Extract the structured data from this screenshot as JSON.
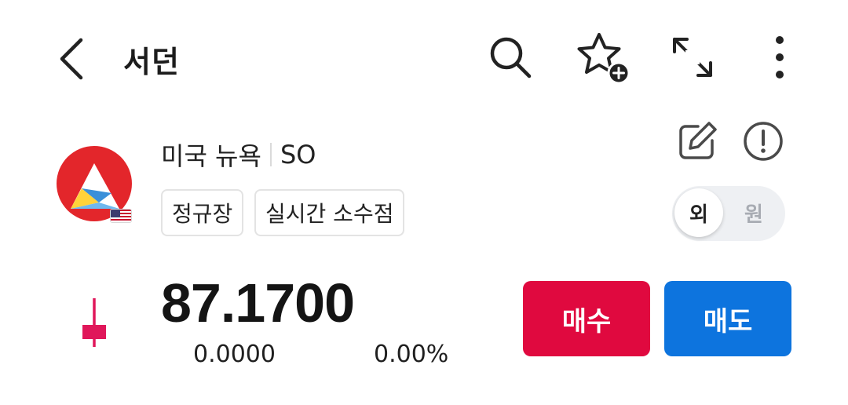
{
  "header": {
    "title": "서던",
    "icons": [
      "chevron-left-icon",
      "search-icon",
      "star-plus-icon",
      "expand-icon",
      "more-vertical-icon"
    ]
  },
  "stock": {
    "market": "미국 뉴욕",
    "ticker": "SO",
    "tags": [
      "정규장",
      "실시간 소수점"
    ],
    "currency_toggle": {
      "foreign": "외",
      "won": "원",
      "selected": "외"
    }
  },
  "price": {
    "value": "87.1700",
    "change": "0.0000",
    "change_percent": "0.00%"
  },
  "actions": {
    "buy": "매수",
    "sell": "매도"
  },
  "colors": {
    "buy": "#e0093f",
    "sell": "#0d74de",
    "logo_red": "#e3262b",
    "candle": "#e0175a"
  }
}
